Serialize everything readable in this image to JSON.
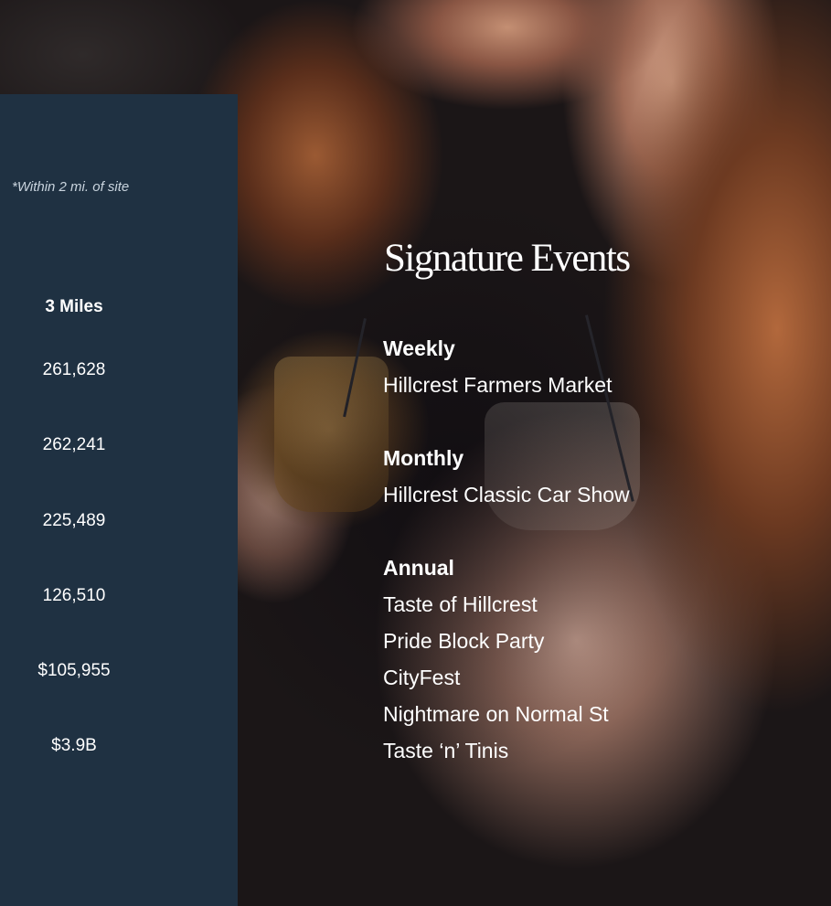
{
  "stats": {
    "note": "*Within 2 mi. of site",
    "column_header": "3 Miles",
    "values": [
      "261,628",
      "262,241",
      "225,489",
      "126,510",
      "$105,955",
      "$3.9B"
    ]
  },
  "events": {
    "title": "Signature Events",
    "groups": [
      {
        "frequency": "Weekly",
        "items": [
          "Hillcrest Farmers Market"
        ]
      },
      {
        "frequency": "Monthly",
        "items": [
          "Hillcrest Classic Car Show"
        ]
      },
      {
        "frequency": "Annual",
        "items": [
          "Taste of Hillcrest",
          "Pride Block Party",
          "CityFest",
          "Nightmare on Normal St",
          "Taste ‘n’ Tinis"
        ]
      }
    ]
  },
  "colors": {
    "panel": "#1f3142",
    "text": "#ffffff",
    "note_text": "#c9d4de"
  }
}
